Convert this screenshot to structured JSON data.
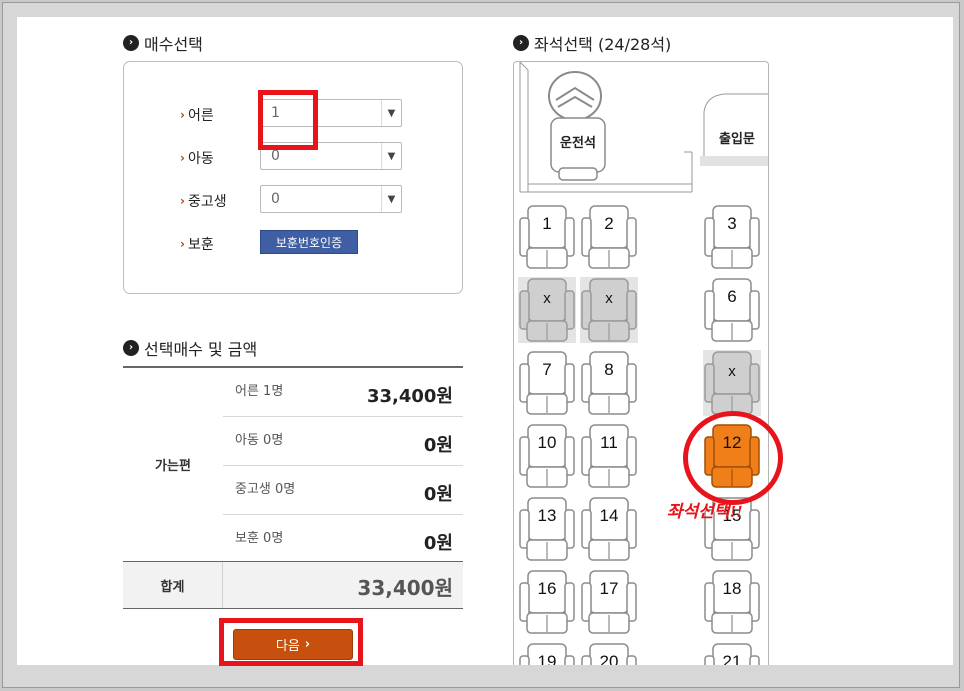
{
  "ticket_count": {
    "title": "매수선택",
    "rows": [
      {
        "label": "어른",
        "value": "1"
      },
      {
        "label": "아동",
        "value": "0"
      },
      {
        "label": "중고생",
        "value": "0"
      }
    ],
    "veteran_label": "보훈",
    "veteran_button": "보훈번호인증"
  },
  "summary": {
    "title": "선택매수 및 금액",
    "group_label": "가는편",
    "rows": [
      {
        "name": "어른 1명",
        "amount": "33,400원"
      },
      {
        "name": "아동 0명",
        "amount": "0원"
      },
      {
        "name": "중고생 0명",
        "amount": "0원"
      },
      {
        "name": "보훈 0명",
        "amount": "0원"
      }
    ],
    "total_label": "합계",
    "total_amount": "33,400원"
  },
  "next_button": "다음",
  "seat_selection": {
    "title": "좌석선택 (24/28석)",
    "driver_label": "운전석",
    "entrance_label": "출입문",
    "annotation": "좌석선택!!",
    "seats": [
      {
        "label": "1",
        "state": "available"
      },
      {
        "label": "2",
        "state": "available"
      },
      {
        "label": "3",
        "state": "available"
      },
      {
        "label": "x",
        "state": "taken"
      },
      {
        "label": "x",
        "state": "taken"
      },
      {
        "label": "6",
        "state": "available"
      },
      {
        "label": "7",
        "state": "available"
      },
      {
        "label": "8",
        "state": "available"
      },
      {
        "label": "x",
        "state": "taken"
      },
      {
        "label": "10",
        "state": "available"
      },
      {
        "label": "11",
        "state": "available"
      },
      {
        "label": "12",
        "state": "selected"
      },
      {
        "label": "13",
        "state": "available"
      },
      {
        "label": "14",
        "state": "available"
      },
      {
        "label": "15",
        "state": "available"
      },
      {
        "label": "16",
        "state": "available"
      },
      {
        "label": "17",
        "state": "available"
      },
      {
        "label": "18",
        "state": "available"
      },
      {
        "label": "19",
        "state": "available"
      },
      {
        "label": "20",
        "state": "available"
      },
      {
        "label": "21",
        "state": "available"
      }
    ]
  },
  "colors": {
    "accent_orange": "#c7500e",
    "selected_seat": "#f07f1a",
    "highlight_red": "#e8141b",
    "button_blue": "#3f5ea4",
    "taken_seat": "#d4d4d4"
  }
}
